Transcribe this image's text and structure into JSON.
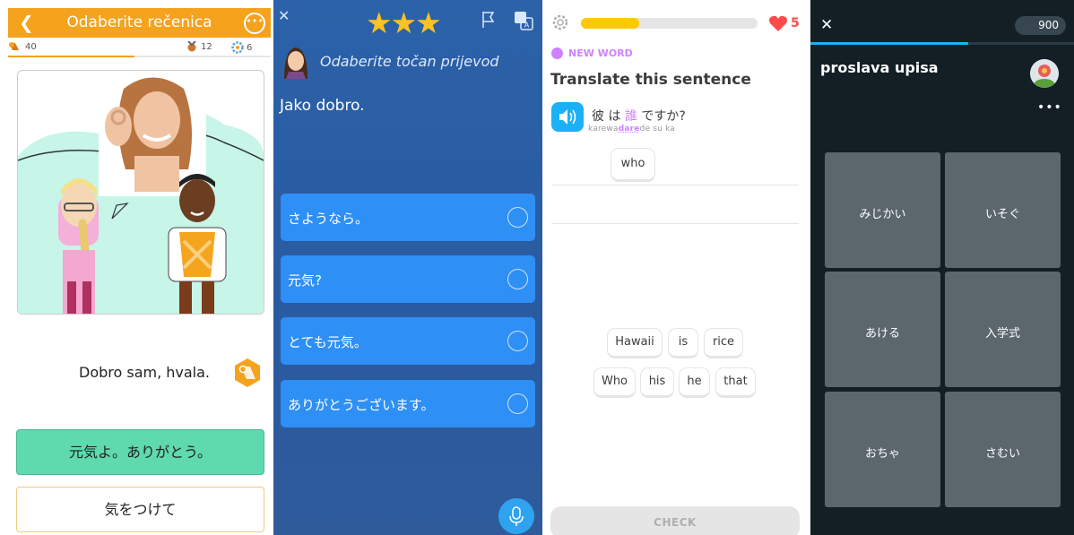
{
  "panel1": {
    "title": "Odaberite rečenica",
    "back_icon": "chevron-left-icon",
    "more_icon": "ellipsis-circle-icon",
    "stats": {
      "badge_count": "40",
      "medal_count": "12",
      "gear_count": "6"
    },
    "progress": 0.48,
    "answer_text": "Dobro sam, hvala.",
    "options": [
      "元気よ。ありがとう。",
      "気をつけて"
    ],
    "colors": {
      "accent": "#f5a21d",
      "selected": "#5fd9ae"
    }
  },
  "panel2": {
    "close_icon": "close-icon",
    "stars": "★★★",
    "instruction": "Odaberite točan prijevod",
    "prompt": "Jako dobro.",
    "choices": [
      "さようなら。",
      "元気?",
      "とても元気。",
      "ありがとうございます。"
    ],
    "colors": {
      "background": "#2b62a9",
      "choice": "#2e8ff5",
      "star": "#ffc21e"
    }
  },
  "panel3": {
    "hearts": "5",
    "progress": 0.33,
    "tag": "NEW WORD",
    "heading": "Translate this sentence",
    "sentence": {
      "pre": "彼 は ",
      "new": "誰",
      "post": " ですか?"
    },
    "romaji": {
      "pre": "karewa",
      "new": "dare",
      "post": "de su ka"
    },
    "answer_tile": "who",
    "bank_row1": [
      "Hawaii",
      "is",
      "rice"
    ],
    "bank_row2": [
      "Who",
      "his",
      "he",
      "that"
    ],
    "check_label": "CHECK",
    "colors": {
      "new_word": "#ce82ff",
      "speaker": "#1cb0f6",
      "heart": "#ff4b4b"
    }
  },
  "panel4": {
    "close_icon": "close-icon",
    "xp": "900",
    "progress": 0.6,
    "title": "proslava upisa",
    "more": "•••",
    "cards": [
      "みじかい",
      "いそぐ",
      "あける",
      "入学式",
      "おちゃ",
      "さむい"
    ],
    "colors": {
      "background": "#131f24",
      "card": "#5b666d"
    }
  }
}
